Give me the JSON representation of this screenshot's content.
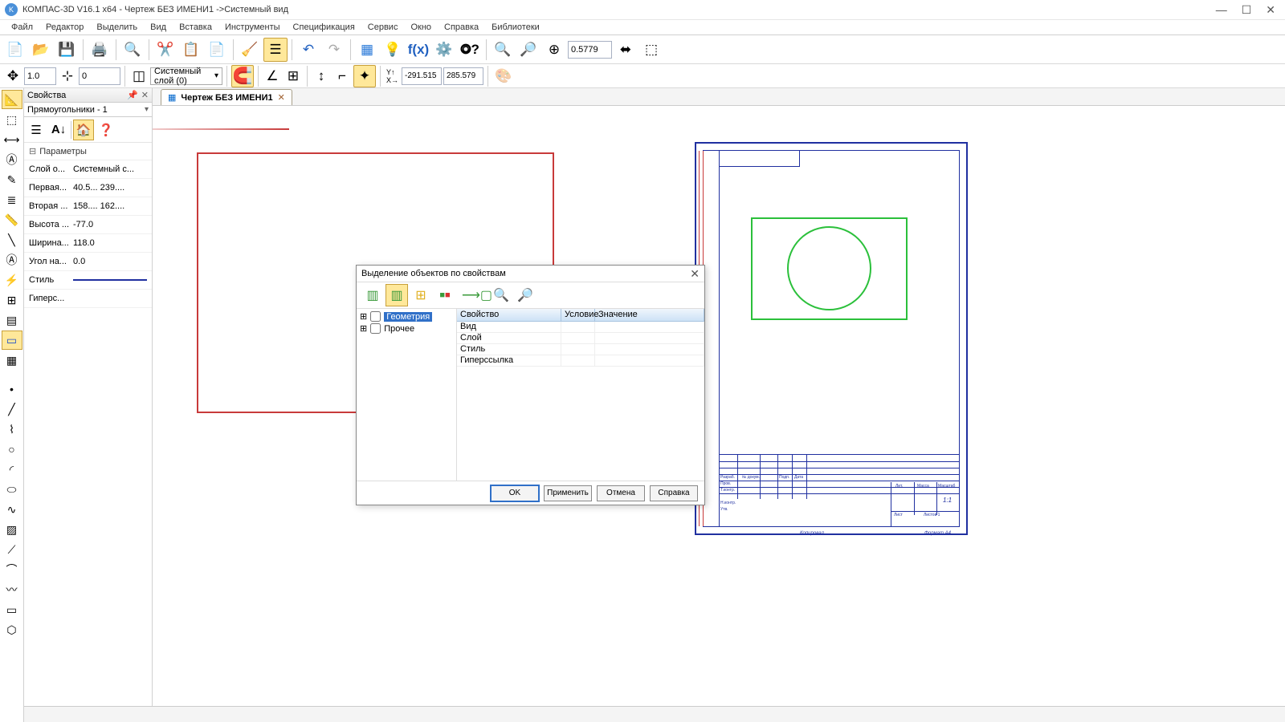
{
  "title": "КОМПАС-3D V16.1 x64 - Чертеж БЕЗ ИМЕНИ1 ->Системный вид",
  "app_icon_letter": "K",
  "window_controls": {
    "min": "—",
    "max": "☐",
    "close": "✕"
  },
  "menu": [
    "Файл",
    "Редактор",
    "Выделить",
    "Вид",
    "Вставка",
    "Инструменты",
    "Спецификация",
    "Сервис",
    "Окно",
    "Справка",
    "Библиотеки"
  ],
  "toolbar2": {
    "field1": "1.0",
    "field2": "0",
    "layer_combo": "Системный слой (0)"
  },
  "zoom_value": "0.5779",
  "coords": {
    "x": "-291.515",
    "y": "285.579"
  },
  "doc_tab": "Чертеж БЕЗ ИМЕНИ1",
  "properties": {
    "panel_title": "Свойства",
    "type_name": "Прямоугольники - 1",
    "params_header": "Параметры",
    "rows": [
      {
        "label": "Слой о...",
        "value": "Системный с..."
      },
      {
        "label": "Первая...",
        "value": "40.5...   239...."
      },
      {
        "label": "Вторая ...",
        "value": "158....   162...."
      },
      {
        "label": "Высота ...",
        "value": "-77.0"
      },
      {
        "label": "Ширина...",
        "value": "118.0"
      },
      {
        "label": "Угол на...",
        "value": "0.0"
      },
      {
        "label": "Стиль",
        "value": ""
      },
      {
        "label": "Гиперс...",
        "value": ""
      }
    ]
  },
  "dialog": {
    "title": "Выделение объектов по свойствам",
    "tree": [
      {
        "label": "Геометрия",
        "selected": true
      },
      {
        "label": "Прочее",
        "selected": false
      }
    ],
    "grid_headers": [
      "Свойство",
      "Условие",
      "Значение"
    ],
    "grid_rows": [
      "Вид",
      "Слой",
      "Стиль",
      "Гиперссылка"
    ],
    "buttons": {
      "ok": "OK",
      "apply": "Применить",
      "cancel": "Отмена",
      "help": "Справка"
    }
  },
  "titleblock_texts": {
    "t1": "Разраб.",
    "t2": "Пров.",
    "t3": "Т.контр.",
    "t4": "Н.контр.",
    "t5": "Утв.",
    "t6": "№ докум.",
    "t7": "Подп.",
    "t8": "Дата",
    "t9": "Лит.",
    "t10": "Масса",
    "t11": "Масштаб",
    "t12": "1:1",
    "t13": "Лист",
    "t14": "Листов 1",
    "t15": "Копировал",
    "t16": "Формат   А4"
  }
}
